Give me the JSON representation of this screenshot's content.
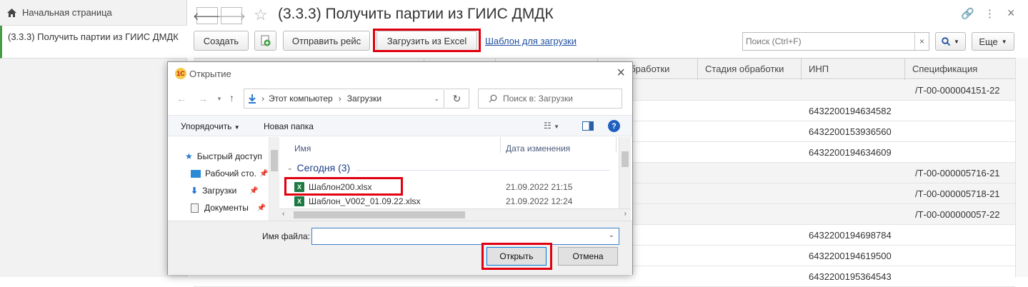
{
  "sidebar": {
    "home_label": "Начальная страница",
    "active_item": "(3.3.3) Получить партии из ГИИС ДМДК"
  },
  "header": {
    "title": "(3.3.3) Получить партии из ГИИС ДМДК"
  },
  "toolbar": {
    "create": "Создать",
    "send_trip": "Отправить рейс",
    "load_excel": "Загрузить из Excel",
    "template_link": "Шаблон для загрузки",
    "search_placeholder": "Поиск (Ctrl+F)",
    "more": "Еще"
  },
  "table": {
    "headers": [
      "обработки",
      "Стадия обработки",
      "ИНП",
      "Спецификация"
    ],
    "rows": [
      {
        "inp": "",
        "spec": "/Т-00-000004151-22"
      },
      {
        "inp": "6432200194634582",
        "spec": ""
      },
      {
        "inp": "6432200153936560",
        "spec": ""
      },
      {
        "inp": "6432200194634609",
        "spec": ""
      },
      {
        "inp": "",
        "spec": "/Т-00-000005716-21"
      },
      {
        "inp": "",
        "spec": "/Т-00-000005718-21"
      },
      {
        "inp": "",
        "spec": "/Т-00-000000057-22"
      },
      {
        "inp": "6432200194698784",
        "spec": ""
      },
      {
        "inp": "6432200194619500",
        "spec": ""
      },
      {
        "inp": "6432200195364543",
        "spec": ""
      }
    ]
  },
  "dialog": {
    "title": "Открытие",
    "breadcrumb": [
      "Этот компьютер",
      "Загрузки"
    ],
    "search_placeholder": "Поиск в: Загрузки",
    "organize": "Упорядочить",
    "new_folder": "Новая папка",
    "nav": [
      "Быстрый доступ",
      "Рабочий сто.",
      "Загрузки",
      "Документы"
    ],
    "col_name": "Имя",
    "col_date": "Дата изменения",
    "group": "Сегодня (3)",
    "files": [
      {
        "name": "Шаблон200.xlsx",
        "date": "21.09.2022 21:15"
      },
      {
        "name": "Шаблон_V002_01.09.22.xlsx",
        "date": "21.09.2022 12:24"
      }
    ],
    "filename_label": "Имя файла:",
    "filename_value": "",
    "open": "Открыть",
    "cancel": "Отмена"
  },
  "colors": {
    "accent_green": "#4a9b44",
    "highlight_red": "#e0000f",
    "link_blue": "#1f50a0",
    "excel_green": "#1d7a43"
  }
}
